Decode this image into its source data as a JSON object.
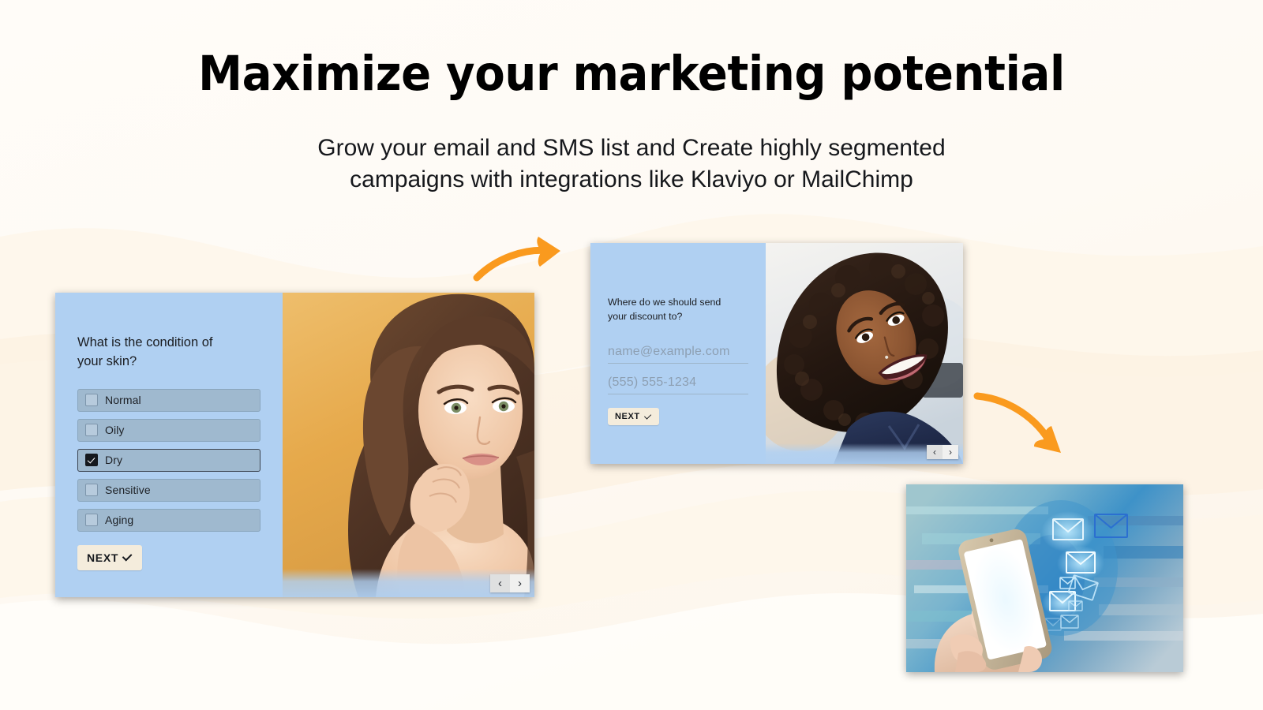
{
  "theme": {
    "background_cream": "#FEFBF6",
    "background_peach": "#FDF2E3",
    "arrow_orange": "#FA9A1E",
    "popup_panel_blue": "#B0D0F2",
    "option_row_blue": "#9FB9CF",
    "next_button_cream": "#F4ECDC",
    "title_color": "#000000"
  },
  "hero": {
    "title": "Maximize your marketing potential",
    "subtitle": "Grow your email and SMS list and Create highly segmented\ncampaigns with integrations like Klaviyo or MailChimp"
  },
  "quiz_popup": {
    "question": "What is the condition of\nyour skin?",
    "options": [
      {
        "label": "Normal",
        "checked": false
      },
      {
        "label": "Oily",
        "checked": false
      },
      {
        "label": "Dry",
        "checked": true
      },
      {
        "label": "Sensitive",
        "checked": false
      },
      {
        "label": "Aging",
        "checked": false
      }
    ],
    "next_label": "NEXT",
    "nav": {
      "prev": "‹",
      "next": "›"
    },
    "photo_alt": "woman with wavy brown hair resting chin on hand, golden background"
  },
  "email_popup": {
    "question": "Where do we should send\nyour discount to?",
    "fields": [
      {
        "name": "email",
        "placeholder": "name@example.com",
        "value": ""
      },
      {
        "name": "phone",
        "placeholder": "(555) 555-1234",
        "value": ""
      }
    ],
    "next_label": "NEXT",
    "nav": {
      "prev": "‹",
      "next": "›"
    },
    "photo_alt": "smiling woman with curly hair in navy top"
  },
  "email_blast_card": {
    "alt": "hand holding white smartphone with glowing envelope icons"
  }
}
